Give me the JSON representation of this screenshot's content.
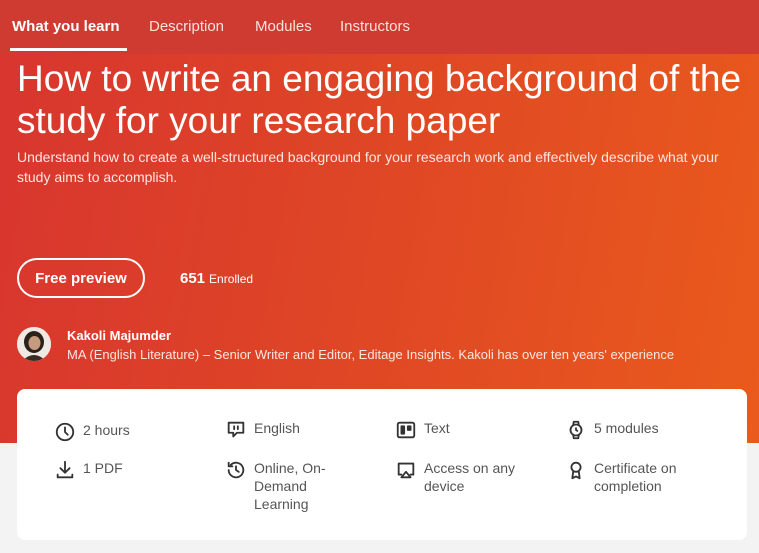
{
  "nav": {
    "tabs": [
      "What you learn",
      "Description",
      "Modules",
      "Instructors"
    ]
  },
  "course": {
    "title": "How to write an engaging background of the study for your research paper",
    "subtitle": "Understand how to create a well-structured background for your research work and effectively describe what your study aims to accomplish.",
    "preview_label": "Free preview",
    "enrolled_count": "651",
    "enrolled_label": "Enrolled"
  },
  "instructor": {
    "name": "Kakoli Majumder",
    "bio": "MA (English Literature) – Senior Writer and Editor, Editage Insights. Kakoli has over ten years' experience"
  },
  "features": [
    {
      "icon": "clock-icon",
      "label": "2 hours"
    },
    {
      "icon": "language-icon",
      "label": "English"
    },
    {
      "icon": "text-format-icon",
      "label": "Text"
    },
    {
      "icon": "watch-icon",
      "label": "5 modules"
    },
    {
      "icon": "download-icon",
      "label": "1 PDF"
    },
    {
      "icon": "history-icon",
      "label": "Online, On-Demand Learning"
    },
    {
      "icon": "device-icon",
      "label": "Access on any device"
    },
    {
      "icon": "certificate-icon",
      "label": "Certificate on completion"
    }
  ],
  "colors": {
    "hero_start": "#d8352f",
    "hero_end": "#ea5a1c",
    "nav_bg": "#cf3b31",
    "card_bg": "#ffffff",
    "page_bg": "#f3f3f3"
  }
}
